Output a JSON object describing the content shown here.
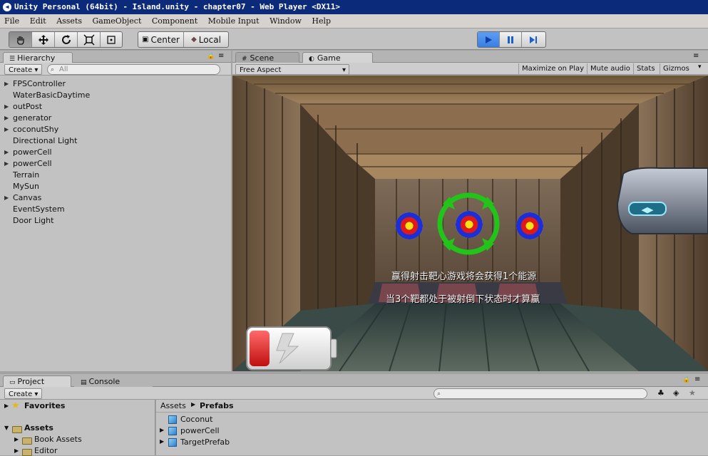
{
  "window": {
    "title": "Unity Personal (64bit) - Island.unity - chapter07 - Web Player <DX11>"
  },
  "menu": [
    "File",
    "Edit",
    "Assets",
    "GameObject",
    "Component",
    "Mobile Input",
    "Window",
    "Help"
  ],
  "toolbar": {
    "pivot_label": "Center",
    "space_label": "Local",
    "tool_icons": [
      "hand-icon",
      "move-icon",
      "rotate-icon",
      "scale-icon",
      "rect-icon"
    ],
    "play_icons": [
      "play-icon",
      "pause-icon",
      "step-icon"
    ]
  },
  "hierarchy": {
    "tab": "Hierarchy",
    "create": "Create",
    "search_placeholder": "All",
    "items": [
      {
        "label": "FPSController",
        "expandable": true
      },
      {
        "label": "WaterBasicDaytime",
        "expandable": false
      },
      {
        "label": "outPost",
        "expandable": true
      },
      {
        "label": "generator",
        "expandable": true
      },
      {
        "label": "coconutShy",
        "expandable": true
      },
      {
        "label": "Directional Light",
        "expandable": false
      },
      {
        "label": "powerCell",
        "expandable": true
      },
      {
        "label": "powerCell",
        "expandable": true
      },
      {
        "label": "Terrain",
        "expandable": false
      },
      {
        "label": "MySun",
        "expandable": false
      },
      {
        "label": "Canvas",
        "expandable": true
      },
      {
        "label": "EventSystem",
        "expandable": false
      },
      {
        "label": "Door Light",
        "expandable": false
      }
    ]
  },
  "scene_tab": "Scene",
  "game": {
    "tab": "Game",
    "aspect": "Free Aspect",
    "options": [
      "Maximize on Play",
      "Mute audio",
      "Stats",
      "Gizmos"
    ],
    "hud_line1": "赢得射击靶心游戏将会获得1个能源",
    "hud_line2": "当3个靶都处于被射倒下状态时才算赢"
  },
  "project": {
    "tab": "Project",
    "console_tab": "Console",
    "create": "Create",
    "favorites": "Favorites",
    "assets": "Assets",
    "folders": [
      "Book Assets",
      "Editor"
    ],
    "breadcrumb": [
      "Assets",
      "Prefabs"
    ],
    "files": [
      {
        "label": "Coconut",
        "expandable": false
      },
      {
        "label": "powerCell",
        "expandable": true
      },
      {
        "label": "TargetPrefab",
        "expandable": true
      }
    ]
  }
}
